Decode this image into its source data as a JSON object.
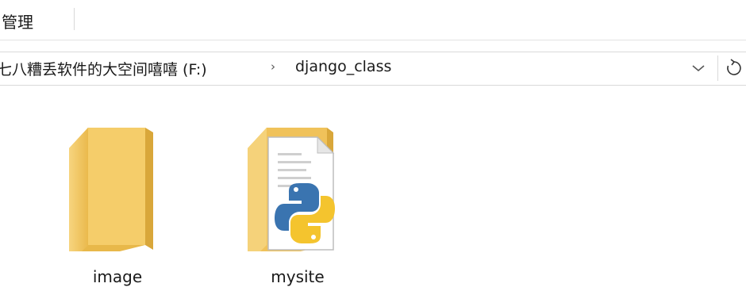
{
  "ribbon": {
    "tab_label": "管理"
  },
  "address": {
    "drive_label": "七八糟丢软件的大空间嘻嘻 (F:)",
    "separator": "›",
    "folder_label": "django_class"
  },
  "files": [
    {
      "name": "image",
      "icon": "folder-icon"
    },
    {
      "name": "mysite",
      "icon": "python-file-folder-icon"
    }
  ]
}
